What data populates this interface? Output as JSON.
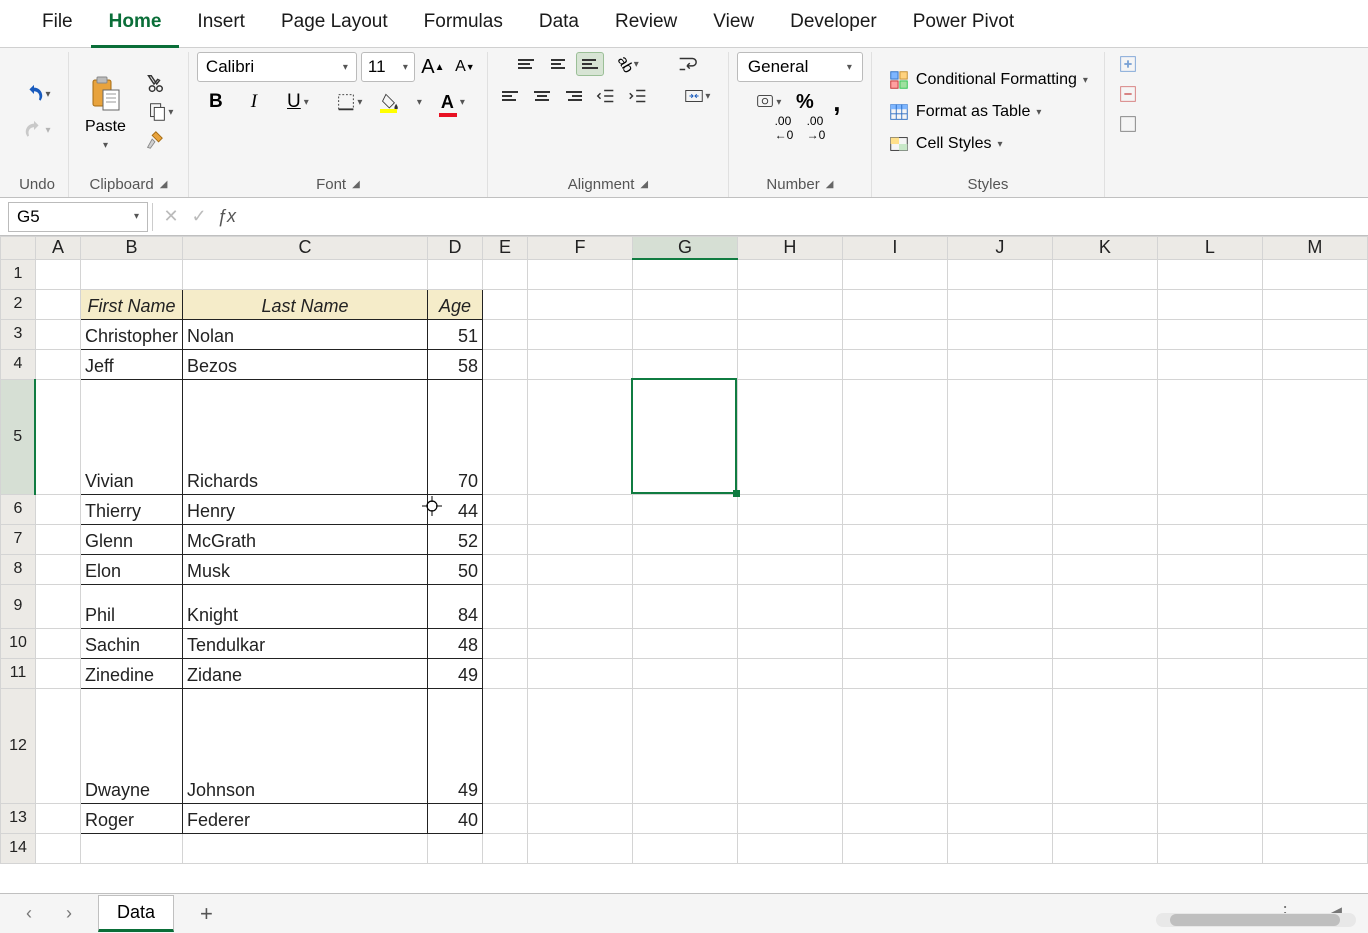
{
  "tabs": [
    "File",
    "Home",
    "Insert",
    "Page Layout",
    "Formulas",
    "Data",
    "Review",
    "View",
    "Developer",
    "Power Pivot"
  ],
  "activeTab": "Home",
  "ribbon": {
    "undo_label": "Undo",
    "clipboard_label": "Clipboard",
    "paste_label": "Paste",
    "font_label": "Font",
    "font_name": "Calibri",
    "font_size": "11",
    "alignment_label": "Alignment",
    "number_label": "Number",
    "number_format": "General",
    "styles_label": "Styles",
    "cond_fmt": "Conditional Formatting",
    "fmt_table": "Format as Table",
    "cell_styles": "Cell Styles"
  },
  "nameBox": "G5",
  "formula": "",
  "columns": [
    "A",
    "B",
    "C",
    "D",
    "E",
    "F",
    "G",
    "H",
    "I",
    "J",
    "K",
    "L",
    "M"
  ],
  "selectedCol": "G",
  "rowNumbers": [
    1,
    2,
    3,
    4,
    5,
    6,
    7,
    8,
    9,
    10,
    11,
    12,
    13,
    14
  ],
  "selectedRow": 5,
  "rowHeights": {
    "1": 12,
    "3": 30,
    "4": 22,
    "5": 115,
    "6": 30,
    "7": 22,
    "8": 30,
    "9": 44,
    "10": 30,
    "11": 30,
    "12": 115,
    "13": 30,
    "14": 30
  },
  "headers": {
    "first": "First Name",
    "last": "Last Name",
    "age": "Age"
  },
  "people": [
    {
      "first": "Christopher",
      "last": "Nolan",
      "age": 51
    },
    {
      "first": "Jeff",
      "last": "Bezos",
      "age": 58
    },
    {
      "first": "Vivian",
      "last": "Richards",
      "age": 70
    },
    {
      "first": "Thierry",
      "last": "Henry",
      "age": 44
    },
    {
      "first": "Glenn",
      "last": "McGrath",
      "age": 52
    },
    {
      "first": "Elon",
      "last": "Musk",
      "age": 50
    },
    {
      "first": "Phil",
      "last": "Knight",
      "age": 84
    },
    {
      "first": "Sachin",
      "last": "Tendulkar",
      "age": 48
    },
    {
      "first": "Zinedine",
      "last": "Zidane",
      "age": 49
    },
    {
      "first": "Dwayne",
      "last": "Johnson",
      "age": 49
    },
    {
      "first": "Roger",
      "last": "Federer",
      "age": 40
    }
  ],
  "sheetTab": "Data"
}
